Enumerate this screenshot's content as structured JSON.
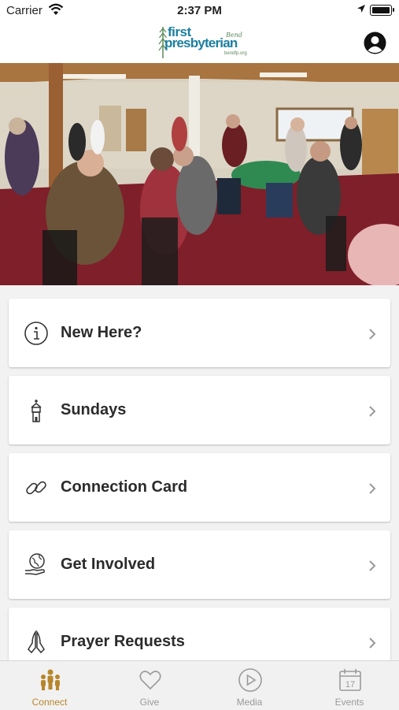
{
  "status_bar": {
    "carrier": "Carrier",
    "time": "2:37 PM"
  },
  "header": {
    "logo_line1": "first",
    "logo_line2": "presbyterian",
    "logo_script": "Bend",
    "logo_url": "bendfp.org",
    "profile_icon": "user-circle-icon"
  },
  "hero": {
    "image": "fellowship-hall-gathering-photo"
  },
  "menu": [
    {
      "label": "New Here?",
      "icon": "info-circle-icon"
    },
    {
      "label": "Sundays",
      "icon": "church-icon"
    },
    {
      "label": "Connection Card",
      "icon": "link-icon"
    },
    {
      "label": "Get Involved",
      "icon": "globe-hand-icon"
    },
    {
      "label": "Prayer Requests",
      "icon": "praying-hands-icon"
    }
  ],
  "tabs": [
    {
      "label": "Connect",
      "icon": "people-icon",
      "active": true
    },
    {
      "label": "Give",
      "icon": "heart-icon",
      "active": false
    },
    {
      "label": "Media",
      "icon": "play-circle-icon",
      "active": false
    },
    {
      "label": "Events",
      "icon": "calendar-icon",
      "date": "17",
      "active": false
    }
  ],
  "colors": {
    "accent": "#b8862b",
    "inactive": "#9a9a9a",
    "logo": "#1a7fa0"
  }
}
